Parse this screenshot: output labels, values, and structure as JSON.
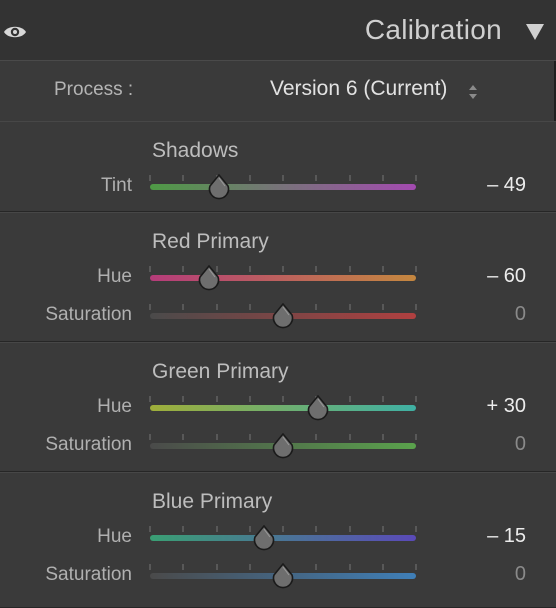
{
  "panel": {
    "title": "Calibration",
    "visibility_icon": "eye-icon",
    "collapse_icon": "triangle-down-icon"
  },
  "process": {
    "label": "Process :",
    "value": "Version 6 (Current)",
    "icon": "updown-chevron-icon"
  },
  "sections": [
    {
      "title": "Shadows",
      "rows": [
        {
          "label": "Tint",
          "value": "– 49",
          "level": 0.26,
          "gradient": [
            "#4e9a45",
            "#a34ab0"
          ]
        }
      ]
    },
    {
      "title": "Red Primary",
      "rows": [
        {
          "label": "Hue",
          "value": "– 60",
          "level": 0.22,
          "gradient": [
            "#b53c7a",
            "#c4873f"
          ]
        },
        {
          "label": "Saturation",
          "value": "0",
          "level": 0.5,
          "gradient": [
            "#4a4a4a",
            "#b04040"
          ]
        }
      ]
    },
    {
      "title": "Green Primary",
      "rows": [
        {
          "label": "Hue",
          "value": "+ 30",
          "level": 0.63,
          "gradient": [
            "#9fae3a",
            "#3fb0a4"
          ]
        },
        {
          "label": "Saturation",
          "value": "0",
          "level": 0.5,
          "gradient": [
            "#4a4a4a",
            "#5aa24c"
          ]
        }
      ]
    },
    {
      "title": "Blue Primary",
      "rows": [
        {
          "label": "Hue",
          "value": "– 15",
          "level": 0.43,
          "gradient": [
            "#3a9f74",
            "#5a4ab8"
          ]
        },
        {
          "label": "Saturation",
          "value": "0",
          "level": 0.5,
          "gradient": [
            "#4a4a4a",
            "#3f7fb8"
          ]
        }
      ]
    }
  ]
}
